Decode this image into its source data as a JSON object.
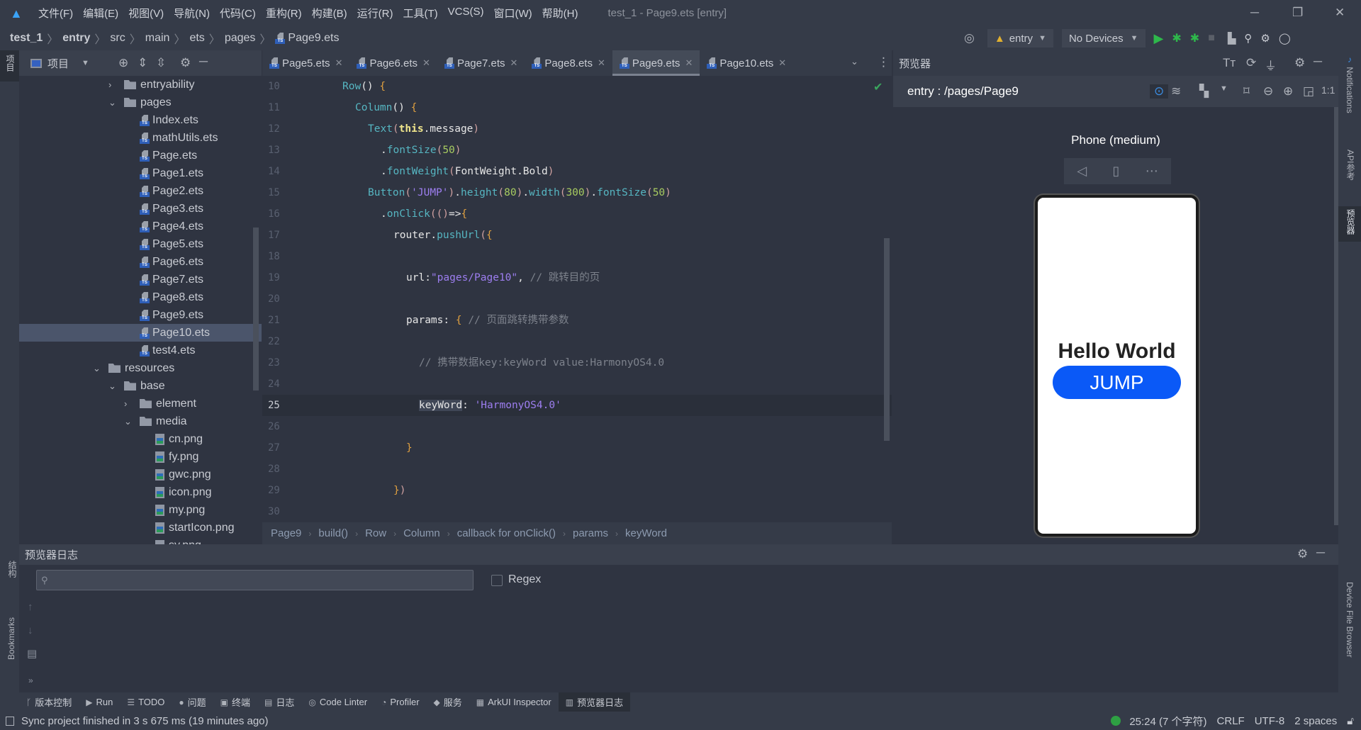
{
  "menubar": {
    "items": [
      "文件(F)",
      "编辑(E)",
      "视图(V)",
      "导航(N)",
      "代码(C)",
      "重构(R)",
      "构建(B)",
      "运行(R)",
      "工具(T)",
      "VCS(S)",
      "窗口(W)",
      "帮助(H)"
    ],
    "title": "test_1 - Page9.ets [entry]"
  },
  "breadcrumb": [
    "test_1",
    "entry",
    "src",
    "main",
    "ets",
    "pages",
    "Page9.ets"
  ],
  "toolbar": {
    "module": "entry",
    "device": "No Devices"
  },
  "project": {
    "title": "项目",
    "strip_label": "项目",
    "tree": [
      {
        "label": "entryability",
        "level": 1,
        "type": "folder",
        "open": false
      },
      {
        "label": "pages",
        "level": 1,
        "type": "folder",
        "open": true
      },
      {
        "label": "Index.ets",
        "level": 2,
        "type": "ts"
      },
      {
        "label": "mathUtils.ets",
        "level": 2,
        "type": "ts"
      },
      {
        "label": "Page.ets",
        "level": 2,
        "type": "ts"
      },
      {
        "label": "Page1.ets",
        "level": 2,
        "type": "ts"
      },
      {
        "label": "Page2.ets",
        "level": 2,
        "type": "ts"
      },
      {
        "label": "Page3.ets",
        "level": 2,
        "type": "ts"
      },
      {
        "label": "Page4.ets",
        "level": 2,
        "type": "ts"
      },
      {
        "label": "Page5.ets",
        "level": 2,
        "type": "ts"
      },
      {
        "label": "Page6.ets",
        "level": 2,
        "type": "ts"
      },
      {
        "label": "Page7.ets",
        "level": 2,
        "type": "ts"
      },
      {
        "label": "Page8.ets",
        "level": 2,
        "type": "ts"
      },
      {
        "label": "Page9.ets",
        "level": 2,
        "type": "ts"
      },
      {
        "label": "Page10.ets",
        "level": 2,
        "type": "ts",
        "selected": true
      },
      {
        "label": "test4.ets",
        "level": 2,
        "type": "ts"
      },
      {
        "label": "resources",
        "level": 0,
        "type": "folder",
        "open": true
      },
      {
        "label": "base",
        "level": 1,
        "type": "folder",
        "open": true
      },
      {
        "label": "element",
        "level": 2,
        "type": "folder",
        "open": false
      },
      {
        "label": "media",
        "level": 2,
        "type": "folder",
        "open": true
      },
      {
        "label": "cn.png",
        "level": 3,
        "type": "png"
      },
      {
        "label": "fy.png",
        "level": 3,
        "type": "png"
      },
      {
        "label": "gwc.png",
        "level": 3,
        "type": "png"
      },
      {
        "label": "icon.png",
        "level": 3,
        "type": "png"
      },
      {
        "label": "my.png",
        "level": 3,
        "type": "png"
      },
      {
        "label": "startIcon.png",
        "level": 3,
        "type": "png"
      },
      {
        "label": "sy.png",
        "level": 3,
        "type": "png"
      }
    ]
  },
  "tabs": [
    {
      "label": "Page5.ets"
    },
    {
      "label": "Page6.ets"
    },
    {
      "label": "Page7.ets"
    },
    {
      "label": "Page8.ets"
    },
    {
      "label": "Page9.ets",
      "active": true
    },
    {
      "label": "Page10.ets"
    }
  ],
  "code": [
    {
      "n": "10",
      "i": 0,
      "t": [
        [
          "fn",
          "Row"
        ],
        [
          "plain",
          "() "
        ],
        [
          "br",
          "{"
        ]
      ]
    },
    {
      "n": "11",
      "i": 1,
      "t": [
        [
          "fn",
          "Column"
        ],
        [
          "plain",
          "() "
        ],
        [
          "br",
          "{"
        ]
      ]
    },
    {
      "n": "12",
      "i": 2,
      "t": [
        [
          "fn",
          "Text"
        ],
        [
          "par",
          "("
        ],
        [
          "kw",
          "this"
        ],
        [
          "plain",
          ".message"
        ],
        [
          "par",
          ")"
        ]
      ]
    },
    {
      "n": "13",
      "i": 3,
      "t": [
        [
          "plain",
          "."
        ],
        [
          "fn",
          "fontSize"
        ],
        [
          "par",
          "("
        ],
        [
          "num",
          "50"
        ],
        [
          "par",
          ")"
        ]
      ]
    },
    {
      "n": "14",
      "i": 3,
      "t": [
        [
          "plain",
          "."
        ],
        [
          "fn",
          "fontWeight"
        ],
        [
          "par",
          "("
        ],
        [
          "plain",
          "FontWeight.Bold"
        ],
        [
          "par",
          ")"
        ]
      ]
    },
    {
      "n": "15",
      "i": 2,
      "t": [
        [
          "fn",
          "Button"
        ],
        [
          "par",
          "("
        ],
        [
          "str",
          "'JUMP'"
        ],
        [
          "par",
          ")"
        ],
        [
          "plain",
          "."
        ],
        [
          "fn",
          "height"
        ],
        [
          "par",
          "("
        ],
        [
          "num",
          "80"
        ],
        [
          "par",
          ")"
        ],
        [
          "plain",
          "."
        ],
        [
          "fn",
          "width"
        ],
        [
          "par",
          "("
        ],
        [
          "num",
          "300"
        ],
        [
          "par",
          ")"
        ],
        [
          "plain",
          "."
        ],
        [
          "fn",
          "fontSize"
        ],
        [
          "par",
          "("
        ],
        [
          "num",
          "50"
        ],
        [
          "par",
          ")"
        ]
      ]
    },
    {
      "n": "16",
      "i": 3,
      "t": [
        [
          "plain",
          "."
        ],
        [
          "fn",
          "onClick"
        ],
        [
          "par",
          "(()"
        ],
        [
          "plain",
          "=>"
        ],
        [
          "br",
          "{"
        ]
      ]
    },
    {
      "n": "17",
      "i": 4,
      "t": [
        [
          "plain",
          "router."
        ],
        [
          "fn",
          "pushUrl"
        ],
        [
          "par",
          "("
        ],
        [
          "br",
          "{"
        ]
      ]
    },
    {
      "n": "18",
      "i": 0,
      "t": []
    },
    {
      "n": "19",
      "i": 5,
      "t": [
        [
          "plain",
          "url:"
        ],
        [
          "str",
          "\"pages/Page10\""
        ],
        [
          "plain",
          ", "
        ],
        [
          "com",
          "// 跳转目的页"
        ]
      ]
    },
    {
      "n": "20",
      "i": 0,
      "t": []
    },
    {
      "n": "21",
      "i": 5,
      "t": [
        [
          "plain",
          "params: "
        ],
        [
          "br",
          "{ "
        ],
        [
          "com",
          "// 页面跳转携带参数"
        ]
      ]
    },
    {
      "n": "22",
      "i": 0,
      "t": []
    },
    {
      "n": "23",
      "i": 6,
      "t": [
        [
          "com",
          "// 携带数据key:keyWord value:HarmonyOS4.0"
        ]
      ]
    },
    {
      "n": "24",
      "i": 0,
      "t": []
    },
    {
      "n": "25",
      "i": 6,
      "t": [
        [
          "hl",
          "keyWord"
        ],
        [
          "plain",
          ": "
        ],
        [
          "str",
          "'HarmonyOS4.0'"
        ]
      ],
      "current": true
    },
    {
      "n": "26",
      "i": 0,
      "t": []
    },
    {
      "n": "27",
      "i": 5,
      "t": [
        [
          "br",
          "}"
        ]
      ]
    },
    {
      "n": "28",
      "i": 0,
      "t": []
    },
    {
      "n": "29",
      "i": 4,
      "t": [
        [
          "br",
          "}"
        ],
        [
          "par",
          ")"
        ]
      ]
    },
    {
      "n": "30",
      "i": 0,
      "t": []
    }
  ],
  "editor_breadcrumb": [
    "Page9",
    "build()",
    "Row",
    "Column",
    "callback for onClick()",
    "params",
    "keyWord"
  ],
  "preview": {
    "title": "预览器",
    "path": "entry : /pages/Page9",
    "device": "Phone (medium)",
    "screen_text": "Hello World",
    "button_label": "JUMP",
    "accent": "#0a59f7"
  },
  "log": {
    "title": "预览器日志",
    "search_placeholder": "",
    "regex_label": "Regex"
  },
  "left_strip": {
    "structure": "结构",
    "bookmarks": "Bookmarks"
  },
  "right_strip": {
    "notifications": "Notifications",
    "api": "API参考",
    "previewer": "预览器",
    "device_files": "Device File Browser"
  },
  "toolwindows": [
    {
      "icon": "branch",
      "label": "版本控制"
    },
    {
      "icon": "▶",
      "label": "Run"
    },
    {
      "icon": "☰",
      "label": "TODO"
    },
    {
      "icon": "●",
      "label": "问题"
    },
    {
      "icon": "▣",
      "label": "终端"
    },
    {
      "icon": "▤",
      "label": "日志"
    },
    {
      "icon": "◎",
      "label": "Code Linter"
    },
    {
      "icon": "◔",
      "label": "Profiler"
    },
    {
      "icon": "◆",
      "label": "服务"
    },
    {
      "icon": "▦",
      "label": "ArkUI Inspector"
    },
    {
      "icon": "▥",
      "label": "预览器日志",
      "active": true
    }
  ],
  "status": {
    "message": "Sync project finished in 3 s 675 ms (19 minutes ago)",
    "position": "25:24 (7 个字符)",
    "line_sep": "CRLF",
    "encoding": "UTF-8",
    "indent": "2 spaces",
    "ok_color": "#2ea043"
  }
}
